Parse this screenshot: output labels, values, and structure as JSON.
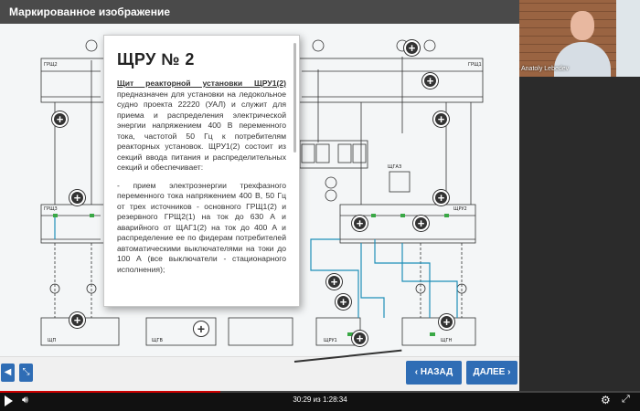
{
  "slide": {
    "title": "Маркированное изображение"
  },
  "diagram": {
    "bus_labels": [
      "ГРЩ2",
      "ГРЩ1",
      "ГРЩ3",
      "ЩРУ2",
      "ЩРУ1",
      "ЩГАЗ",
      "ЩП",
      "ЩГВ",
      "ЩГН",
      "ГРЩ",
      "ЩРУ"
    ]
  },
  "popup": {
    "title": "ЩРУ № 2",
    "lead_underlined": "Щит реакторной установки ЩРУ1(2)",
    "paragraph1": "предназначен для установки на ледокольное судно проекта 22220 (УАЛ) и служит для приема и распределения электрической энергии напряжением 400 В переменного тока, частотой 50 Гц к потребителям реакторных установок. ЩРУ1(2) состоит из секций ввода питания и распределительных секций и обеспечивает:",
    "paragraph2": "- прием электроэнергии трехфазного переменного тока напряжением 400 В, 50 Гц от трех источников - основного ГРЩ1(2) и резервного ГРЩ2(1) на ток до 630 А и аварийного от ЩАГ1(2) на ток до 400 А и распределение ее по фидерам потребителей автоматическими выключателями на токи до 100 А (все выключатели - стационарного исполнения);"
  },
  "footer": {
    "back_label": "‹ НАЗАД",
    "next_label": "ДАЛЕЕ ›"
  },
  "webcam": {
    "name": "Anatoly Lebedev"
  },
  "player": {
    "time": "30:29 из 1:28:34",
    "progress_fraction": 0.344
  },
  "colors": {
    "accent": "#2f6db5",
    "header": "#4a4a4a",
    "wire": "#1f8fb8",
    "marker_green": "#39a845"
  },
  "icons": [
    "sound-icon",
    "resize-icon",
    "play-icon",
    "volume-icon",
    "gear-icon",
    "fullscreen-icon",
    "plus-icon"
  ]
}
